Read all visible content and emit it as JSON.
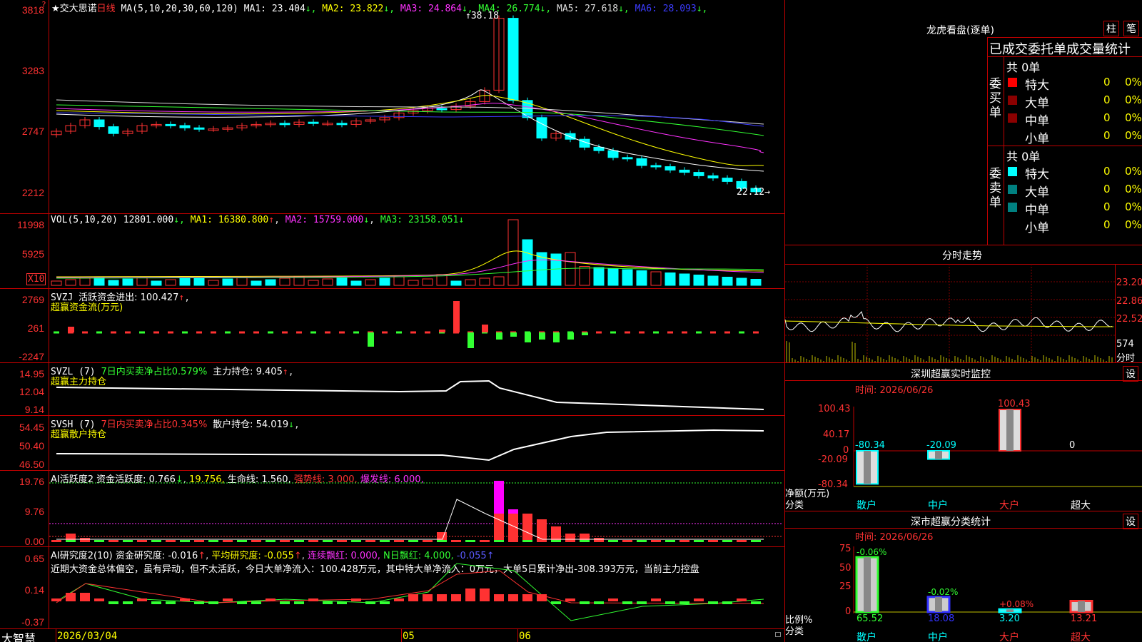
{
  "main_chart": {
    "stock_title": "★交大思诺",
    "period": "日线",
    "ma_label": "MA(5,10,20,30,60,120)",
    "ma_values": [
      {
        "name": "MA1:",
        "value": "23.404",
        "arrow": "↓",
        "color": "#ffffff"
      },
      {
        "name": "MA2:",
        "value": "23.822",
        "arrow": "↓",
        "color": "#ffff00"
      },
      {
        "name": "MA3:",
        "value": "24.864",
        "arrow": "↓",
        "color": "#ff32ff"
      },
      {
        "name": "MA4:",
        "value": "26.774",
        "arrow": "↓",
        "color": "#32ff32"
      },
      {
        "name": "MA5:",
        "value": "27.618",
        "arrow": "↓",
        "color": "#dddddd"
      },
      {
        "name": "MA6:",
        "value": "28.093",
        "arrow": "↓",
        "color": "#3c3cff"
      }
    ],
    "y_ticks": [
      "3818",
      "3283",
      "2747",
      "2212"
    ],
    "high_marker": "38.18",
    "low_marker": "22.12"
  },
  "vol_panel": {
    "label": "VOL(5,10,20)",
    "value": "12801.000",
    "ma1": "MA1: 16380.800",
    "ma2": "MA2: 15759.000",
    "ma3": "MA3: 23158.051",
    "y_ticks": [
      "11998",
      "5925"
    ],
    "unit": "X10"
  },
  "svzj_panel": {
    "label": "SVZJ",
    "desc": "活跃资金进出: 100.427",
    "sub": "超赢资金流(万元)",
    "y_ticks": [
      "2769",
      "261",
      "-2247"
    ]
  },
  "svzl_panel": {
    "label": "SVZL (7)",
    "desc1": "7日内买卖净占比0.579%",
    "desc2": "主力持仓: 9.405",
    "sub": "超赢主力持仓",
    "y_ticks": [
      "14.95",
      "12.04",
      "9.14"
    ]
  },
  "svsh_panel": {
    "label": "SVSH (7)",
    "desc1": "7日内买卖净占比0.345%",
    "desc2": "散户持仓: 54.019",
    "sub": "超赢散户持仓",
    "y_ticks": [
      "54.45",
      "50.40",
      "46.50"
    ]
  },
  "ai_active_panel": {
    "label": "AI活跃度2",
    "d1": "资金活跃度: 0.766",
    "d2": "19.756,",
    "d3": "生命线: 1.560,",
    "d4": "强势线: 3.000,",
    "d5": "爆发线: 6.000,",
    "y_ticks": [
      "19.76",
      "9.76",
      "0.00"
    ]
  },
  "ai_research_panel": {
    "label": "AI研究度2(10)",
    "d1": "资金研究度: -0.016",
    "d2": "平均研究度: -0.055",
    "d3": "连续飘红: 0.000,",
    "d4": "N日飘红: 4.000,",
    "d5": "-0.055",
    "comment": "近期大资金总体偏空，虽有异动，但不太活跃，今日大单净流入：100.428万元，其中特大单净流入：0万元，大单5日累计净出-308.393万元，当前主力控盘",
    "y_ticks": [
      "0.65",
      "0.14",
      "-0.37"
    ]
  },
  "bottom_bar": {
    "brand": "大智慧",
    "dates": [
      "2026/03/04",
      "05",
      "06"
    ]
  },
  "right_panel": {
    "header": "龙虎看盘(逐单)",
    "btn1": "柱",
    "btn2": "笔",
    "table_title": "已成交委托单成交量统计",
    "buy_label": "委买单",
    "sell_label": "委卖单",
    "buy_total": "共 0单",
    "sell_total": "共 0单",
    "buy_rows": [
      {
        "name": "特大",
        "count": "0",
        "pct": "0%",
        "color": "#ff0000"
      },
      {
        "name": "大单",
        "count": "0",
        "pct": "0%",
        "color": "#8b0000"
      },
      {
        "name": "中单",
        "count": "0",
        "pct": "0%",
        "color": "#8b0000"
      },
      {
        "name": "小单",
        "count": "0",
        "pct": "0%",
        "color": "#000000"
      }
    ],
    "sell_rows": [
      {
        "name": "特大",
        "count": "0",
        "pct": "0%",
        "color": "#00ffff"
      },
      {
        "name": "大单",
        "count": "0",
        "pct": "0%",
        "color": "#008080"
      },
      {
        "name": "中单",
        "count": "0",
        "pct": "0%",
        "color": "#008080"
      },
      {
        "name": "小单",
        "count": "0",
        "pct": "0%",
        "color": "#000000"
      }
    ],
    "intraday_title": "分时走势",
    "intraday_ticks": [
      "23.20",
      "22.86",
      "22.52"
    ],
    "intraday_vol": "574",
    "intraday_vol_unit": "分时",
    "monitor_title": "深圳超赢实时监控",
    "monitor_btn": "设",
    "monitor_time": "时间: 2026/06/26",
    "monitor_ticks": [
      "100.43",
      "40.17",
      "0",
      "-20.09",
      "-80.34"
    ],
    "monitor_values": [
      "-80.34",
      "-20.09",
      "100.43",
      "0"
    ],
    "monitor_ylabel": "净额(万元)",
    "monitor_xlabel": "分类",
    "monitor_categories": [
      "散户",
      "中户",
      "大户",
      "超大"
    ],
    "class_title": "深市超赢分类统计",
    "class_btn": "设",
    "class_time": "时间: 2026/06/26",
    "class_ticks": [
      "75",
      "50",
      "25",
      "0"
    ],
    "class_top_labels": [
      "-0.06%",
      "-0.02%",
      "+0.08%"
    ],
    "class_values": [
      "65.52",
      "18.08",
      "3.20",
      "13.21"
    ],
    "class_ylabel": "比例%",
    "class_xlabel": "分类",
    "class_categories": [
      "散户",
      "中户",
      "大户",
      "超大"
    ]
  },
  "colors": {
    "up": "#ff3232",
    "down": "#00ffff",
    "grid": "#c00000",
    "ma1": "#ffffff",
    "ma2": "#ffff00",
    "ma3": "#ff32ff",
    "ma4": "#32ff32",
    "ma6": "#3c3cff"
  }
}
